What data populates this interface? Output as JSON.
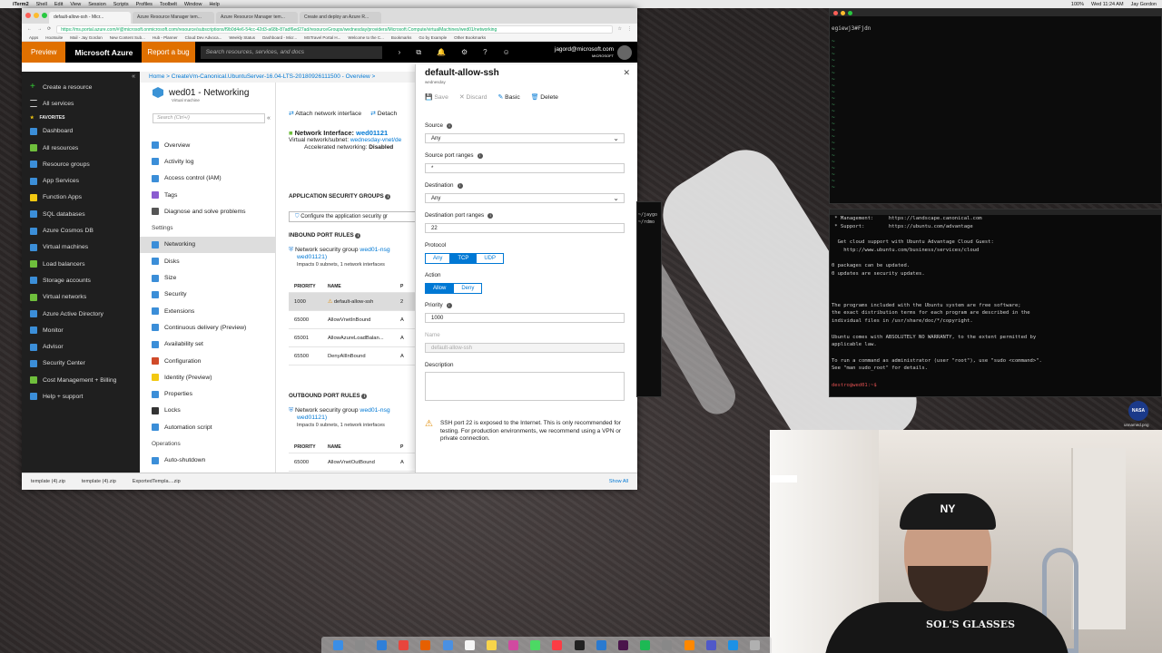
{
  "menubar": {
    "app": "iTerm2",
    "items": [
      "Shell",
      "Edit",
      "View",
      "Session",
      "Scripts",
      "Profiles",
      "Toolbelt",
      "Window",
      "Help"
    ],
    "status": [
      "100%",
      "Wed 11:24 AM",
      "Jay Gordon"
    ]
  },
  "browser": {
    "tabs": [
      "default-allow-ssh - Micr...",
      "Azure Resource Manager tem...",
      "Azure Resource Manager tem...",
      "Create and deploy an Azure R..."
    ],
    "url": "https://ms.portal.azure.com/#@microsoft.onmicrosoft.com/resource/subscriptions/f9b0d4e6-54cc-42d3-a68b-87adf6ed27ad/resourceGroups/wednesday/providers/Microsoft.Compute/virtualMachines/wed01/networking",
    "bookmarks": [
      "Apps",
      "Hootsuite",
      "Mail - Jay Gordon",
      "New Content Sub...",
      "Hub - Planner",
      "Cloud Dev Advoca...",
      "Weekly Status",
      "Dashboard - Micr...",
      "MSTravel Portal H...",
      "Welcome to the C...",
      "Bookmarks",
      "Go by Example",
      "Other Bookmarks"
    ]
  },
  "azure": {
    "preview": "Preview",
    "brand": "Microsoft Azure",
    "report_bug": "Report a bug",
    "search_placeholder": "Search resources, services, and docs",
    "user_name": "jagord@microsoft.com",
    "user_org": "MICROSOFT",
    "breadcrumb": "Home > CreateVm-Canonical.UbuntuServer-16.04-LTS-20180926111500 - Overview >",
    "leftnav": {
      "create": "Create a resource",
      "all_services": "All services",
      "favorites": "FAVORITES",
      "items": [
        {
          "label": "Dashboard",
          "icon": "dashboard-icon",
          "color": "#3b8ed8"
        },
        {
          "label": "All resources",
          "icon": "grid-icon",
          "color": "#6fbf3c"
        },
        {
          "label": "Resource groups",
          "icon": "cube-icon",
          "color": "#3b8ed8"
        },
        {
          "label": "App Services",
          "icon": "globe-icon",
          "color": "#3b8ed8"
        },
        {
          "label": "Function Apps",
          "icon": "bolt-icon",
          "color": "#f2c811"
        },
        {
          "label": "SQL databases",
          "icon": "database-icon",
          "color": "#3b8ed8"
        },
        {
          "label": "Azure Cosmos DB",
          "icon": "planet-icon",
          "color": "#3b8ed8"
        },
        {
          "label": "Virtual machines",
          "icon": "monitor-icon",
          "color": "#3b8ed8"
        },
        {
          "label": "Load balancers",
          "icon": "diamond-icon",
          "color": "#6fbf3c"
        },
        {
          "label": "Storage accounts",
          "icon": "storage-icon",
          "color": "#3b8ed8"
        },
        {
          "label": "Virtual networks",
          "icon": "network-icon",
          "color": "#6fbf3c"
        },
        {
          "label": "Azure Active Directory",
          "icon": "pyramid-icon",
          "color": "#3b8ed8"
        },
        {
          "label": "Monitor",
          "icon": "gauge-icon",
          "color": "#3b8ed8"
        },
        {
          "label": "Advisor",
          "icon": "advisor-icon",
          "color": "#3b8ed8"
        },
        {
          "label": "Security Center",
          "icon": "shield-icon",
          "color": "#3b8ed8"
        },
        {
          "label": "Cost Management + Billing",
          "icon": "coin-icon",
          "color": "#6fbf3c"
        },
        {
          "label": "Help + support",
          "icon": "person-icon",
          "color": "#3b8ed8"
        }
      ]
    },
    "vm": {
      "title": "wed01 - Networking",
      "subtitle": "Virtual machine",
      "search_placeholder": "Search (Ctrl+/)",
      "menu": [
        {
          "label": "Overview",
          "icon": "monitor-icon",
          "color": "#3b8ed8",
          "type": "item"
        },
        {
          "label": "Activity log",
          "icon": "log-icon",
          "color": "#3b8ed8",
          "type": "item"
        },
        {
          "label": "Access control (IAM)",
          "icon": "people-icon",
          "color": "#3b8ed8",
          "type": "item"
        },
        {
          "label": "Tags",
          "icon": "tag-icon",
          "color": "#8a5cd0",
          "type": "item"
        },
        {
          "label": "Diagnose and solve problems",
          "icon": "wrench-icon",
          "color": "#555555",
          "type": "item"
        },
        {
          "label": "Settings",
          "icon": "",
          "color": "",
          "type": "section"
        },
        {
          "label": "Networking",
          "icon": "network-icon",
          "color": "#3b8ed8",
          "type": "active"
        },
        {
          "label": "Disks",
          "icon": "disk-icon",
          "color": "#3b8ed8",
          "type": "item"
        },
        {
          "label": "Size",
          "icon": "size-icon",
          "color": "#3b8ed8",
          "type": "item"
        },
        {
          "label": "Security",
          "icon": "shield-icon",
          "color": "#3b8ed8",
          "type": "item"
        },
        {
          "label": "Extensions",
          "icon": "puzzle-icon",
          "color": "#3b8ed8",
          "type": "item"
        },
        {
          "label": "Continuous delivery (Preview)",
          "icon": "cycle-icon",
          "color": "#3b8ed8",
          "type": "item"
        },
        {
          "label": "Availability set",
          "icon": "availability-icon",
          "color": "#3b8ed8",
          "type": "item"
        },
        {
          "label": "Configuration",
          "icon": "config-icon",
          "color": "#d04a2a",
          "type": "item"
        },
        {
          "label": "Identity (Preview)",
          "icon": "identity-icon",
          "color": "#f2c811",
          "type": "item"
        },
        {
          "label": "Properties",
          "icon": "properties-icon",
          "color": "#3b8ed8",
          "type": "item"
        },
        {
          "label": "Locks",
          "icon": "lock-icon",
          "color": "#333333",
          "type": "item"
        },
        {
          "label": "Automation script",
          "icon": "script-icon",
          "color": "#3b8ed8",
          "type": "item"
        },
        {
          "label": "Operations",
          "icon": "",
          "color": "",
          "type": "section"
        },
        {
          "label": "Auto-shutdown",
          "icon": "clock-icon",
          "color": "#3b8ed8",
          "type": "item"
        }
      ]
    },
    "networking": {
      "attach": "Attach network interface",
      "detach": "Detach",
      "nic_label": "Network Interface:",
      "nic_name": "wed01121",
      "subnet_label": "Virtual network/subnet:",
      "subnet_value": "wednesday-vnet/de",
      "accel_label": "Accelerated networking:",
      "accel_value": "Disabled",
      "asg_heading": "APPLICATION SECURITY GROUPS",
      "asg_button": "Configure the application security gr",
      "inbound_heading": "INBOUND PORT RULES",
      "nsg_label": "Network security group",
      "nsg_name": "wed01-nsg",
      "nsg_name2": "wed01121)",
      "nsg_impacts": "Impacts 0 subnets, 1 network interfaces",
      "col_priority": "PRIORITY",
      "col_name": "NAME",
      "col_port": "P",
      "inbound_rules": [
        {
          "priority": "1000",
          "name": "default-allow-ssh",
          "port": "2",
          "warn": "true"
        },
        {
          "priority": "65000",
          "name": "AllowVnetInBound",
          "port": "A",
          "warn": ""
        },
        {
          "priority": "65001",
          "name": "AllowAzureLoadBalan...",
          "port": "A",
          "warn": ""
        },
        {
          "priority": "65500",
          "name": "DenyAllInBound",
          "port": "A",
          "warn": ""
        }
      ],
      "outbound_heading": "OUTBOUND PORT RULES",
      "outbound_rules": [
        {
          "priority": "65000",
          "name": "AllowVnetOutBound",
          "port": "A"
        }
      ]
    },
    "blade": {
      "title": "default-allow-ssh",
      "subtitle": "wednesday",
      "save": "Save",
      "discard": "Discard",
      "basic": "Basic",
      "delete": "Delete",
      "source_label": "Source",
      "source_value": "Any",
      "source_ports_label": "Source port ranges",
      "source_ports_value": "*",
      "dest_label": "Destination",
      "dest_value": "Any",
      "dest_ports_label": "Destination port ranges",
      "dest_ports_value": "22",
      "protocol_label": "Protocol",
      "protocol_options": [
        "Any",
        "TCP",
        "UDP"
      ],
      "protocol_selected": "TCP",
      "action_label": "Action",
      "action_options": [
        "Allow",
        "Deny"
      ],
      "action_selected": "Allow",
      "priority_label": "Priority",
      "priority_value": "1000",
      "name_label": "Name",
      "name_value": "default-allow-ssh",
      "description_label": "Description",
      "warning": "SSH port 22 is exposed to the Internet. This is only recommended for testing. For production environments, we recommend using a VPN or private connection."
    },
    "downloads": [
      "template (4).zip",
      "template (4).zip",
      "ExportedTempla....zip"
    ],
    "show_all": "Show All"
  },
  "terminal_top": {
    "line": "egiewj3#Fjdn"
  },
  "terminal_bottom": {
    "lines": [
      " * Management:     https://landscape.canonical.com",
      " * Support:        https://ubuntu.com/advantage",
      "",
      "  Get cloud support with Ubuntu Advantage Cloud Guest:",
      "    http://www.ubuntu.com/business/services/cloud",
      "",
      "0 packages can be updated.",
      "0 updates are security updates.",
      "",
      "",
      "",
      "The programs included with the Ubuntu system are free software;",
      "the exact distribution terms for each program are described in the",
      "individual files in /usr/share/doc/*/copyright.",
      "",
      "Ubuntu comes with ABSOLUTELY NO WARRANTY, to the extent permitted by",
      "applicable law.",
      "",
      "To run a command as administrator (user \"root\"), use \"sudo <command>\".",
      "See \"man sudo_root\" for details.",
      ""
    ],
    "prompt": "destro@wed01:~$",
    "badge": "NASA",
    "badge_caption": "unnamed.png"
  },
  "terminal_side": {
    "lines": [
      "~/jaygo",
      "~/rdmo"
    ]
  },
  "webcam": {
    "cap_logo": "NY",
    "shirt_text": "SOL'S GLASSES"
  },
  "dock": {
    "icons": [
      {
        "name": "finder-icon",
        "color": "#3a8ee6"
      },
      {
        "name": "launchpad-icon",
        "color": "#8a8a8a"
      },
      {
        "name": "safari-icon",
        "color": "#2f7fd8"
      },
      {
        "name": "chrome-icon",
        "color": "#e8453c"
      },
      {
        "name": "firefox-icon",
        "color": "#e66000"
      },
      {
        "name": "mail-icon",
        "color": "#4a90e2"
      },
      {
        "name": "calendar-icon",
        "color": "#f5f5f5"
      },
      {
        "name": "notes-icon",
        "color": "#f7d44a"
      },
      {
        "name": "photos-icon",
        "color": "#d04aa0"
      },
      {
        "name": "messages-icon",
        "color": "#4cd964"
      },
      {
        "name": "music-icon",
        "color": "#fc3c44"
      },
      {
        "name": "terminal-icon",
        "color": "#222222"
      },
      {
        "name": "vscode-icon",
        "color": "#2a7ad0"
      },
      {
        "name": "slack-icon",
        "color": "#4a154b"
      },
      {
        "name": "spotify-icon",
        "color": "#1db954"
      },
      {
        "name": "settings-icon",
        "color": "#888888"
      },
      {
        "name": "vlc-icon",
        "color": "#ff8800"
      },
      {
        "name": "teams-icon",
        "color": "#5059c9"
      },
      {
        "name": "docker-icon",
        "color": "#1d91e6"
      },
      {
        "name": "trash-icon",
        "color": "#b0b0b0"
      }
    ]
  }
}
